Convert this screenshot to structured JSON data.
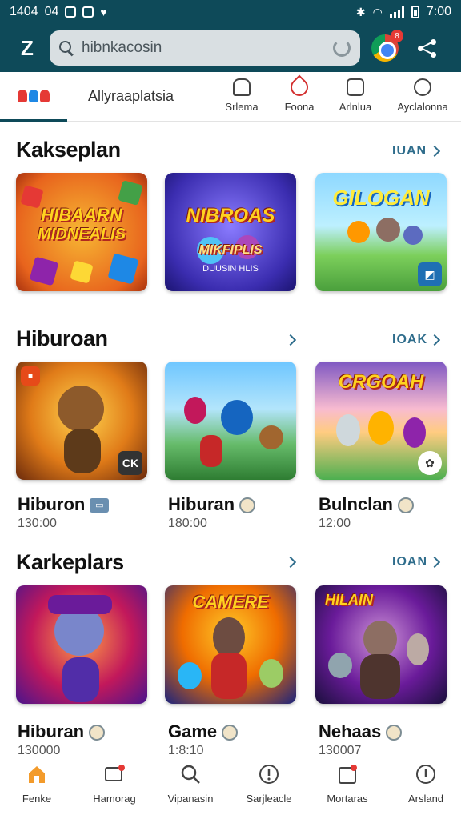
{
  "status_bar": {
    "left_text": "1404",
    "left_text2": "04",
    "time": "7:00"
  },
  "header": {
    "logo": "Z",
    "search": {
      "value": "hibnkacosin",
      "placeholder": "hibnkacosin"
    },
    "browser_badge": "8"
  },
  "nav": {
    "title": "Allyraaplatsia",
    "items": [
      {
        "label": "Srlema",
        "icon": "home-outline-icon"
      },
      {
        "label": "Foona",
        "icon": "drop-icon"
      },
      {
        "label": "Arlnlua",
        "icon": "smiley-box-icon"
      },
      {
        "label": "Ayclalonna",
        "icon": "smiley-face-icon"
      }
    ]
  },
  "sections": [
    {
      "title": "Kakseplan",
      "more_label": "IUAN",
      "cards": [
        {
          "art_text_1": "HIBAARN",
          "art_text_2": "MIDNEALIS"
        },
        {
          "art_text_1": "NIBROAS",
          "art_text_2": "MIKFIPLIS",
          "art_text_3": "DUUSIN HLIS"
        },
        {
          "art_text_1": "GILOGAN"
        }
      ]
    },
    {
      "title": "Hiburoan",
      "more_label": "IOAK",
      "cards": [
        {
          "name": "Hiburon",
          "time": "130:00",
          "corner": "CK"
        },
        {
          "name": "Hiburan",
          "time": "180:00"
        },
        {
          "name": "Bulnclan",
          "time": "12:00",
          "art_text_1": "CRGOAH"
        }
      ]
    },
    {
      "title": "Karkeplars",
      "more_label": "IOAN",
      "cards": [
        {
          "name": "Hiburan",
          "time": "130000"
        },
        {
          "name": "Game",
          "time": "1:8:10",
          "art_text_1": "CAMERE"
        },
        {
          "name": "Nehaas",
          "time": "130007",
          "art_text_1": "HILAIN"
        }
      ]
    }
  ],
  "bottom_nav": [
    {
      "label": "Fenke",
      "icon": "home-icon"
    },
    {
      "label": "Hamorag",
      "icon": "messages-icon"
    },
    {
      "label": "Vipanasin",
      "icon": "search-icon"
    },
    {
      "label": "Sarjleacle",
      "icon": "alert-circle-icon"
    },
    {
      "label": "Mortaras",
      "icon": "notification-box-icon"
    },
    {
      "label": "Arsland",
      "icon": "info-circle-icon"
    }
  ],
  "colors": {
    "header": "#0e4a59",
    "accent": "#2f6d8c",
    "home_active": "#f39b2b"
  }
}
